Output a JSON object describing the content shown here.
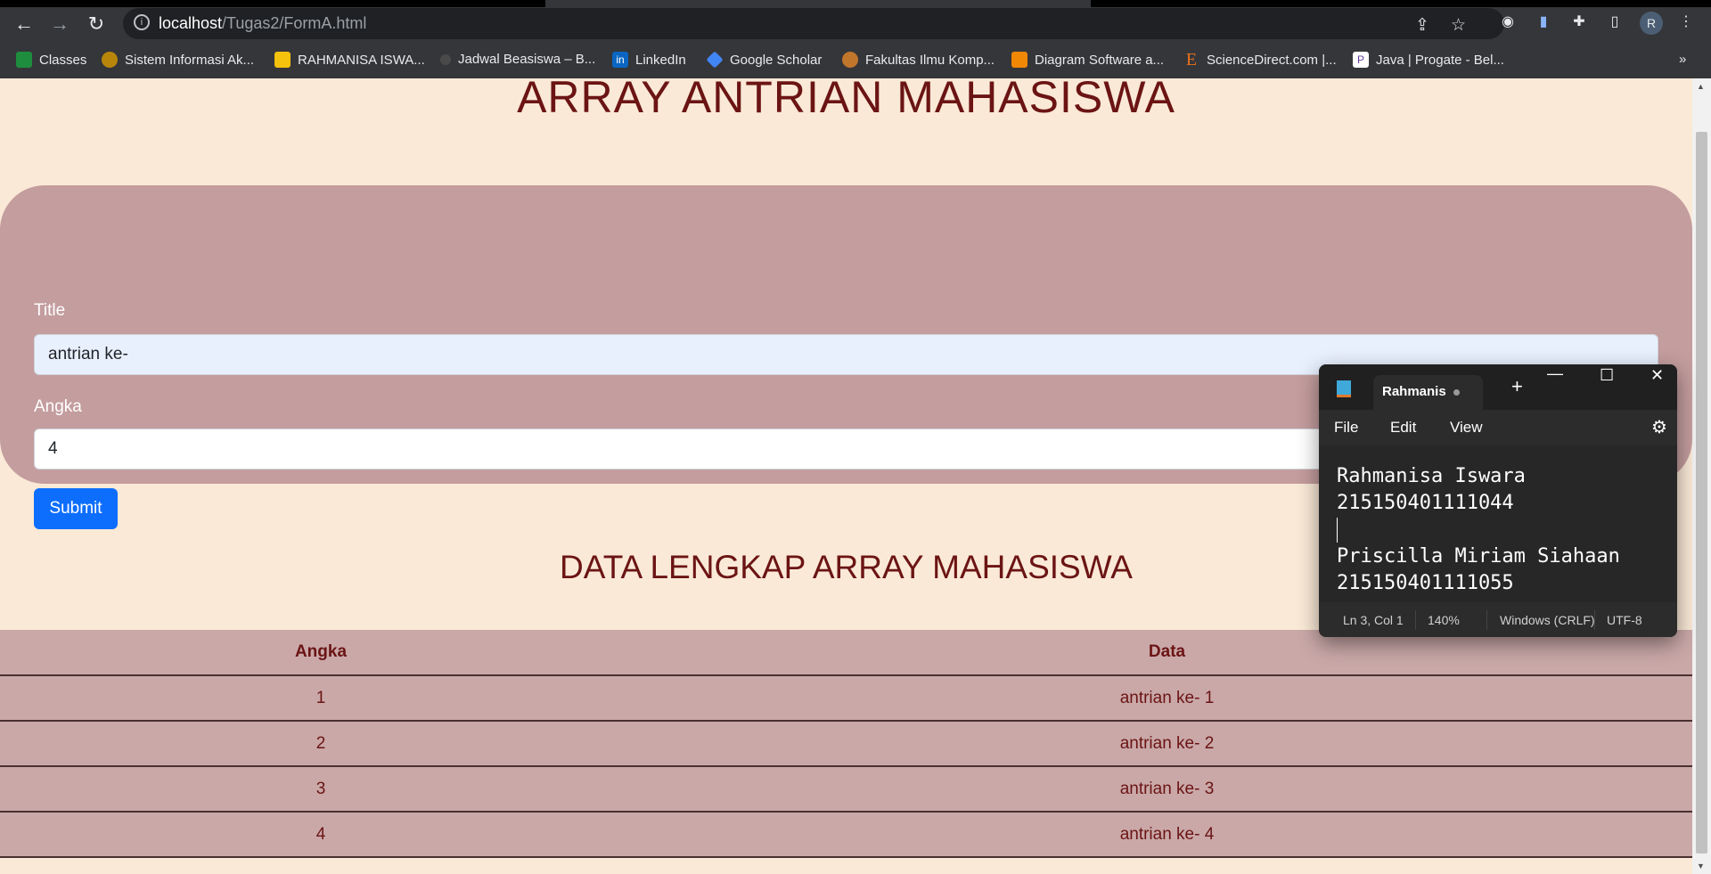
{
  "browser": {
    "url_host": "localhost",
    "url_path": "/Tugas2/FormA.html",
    "avatar_initial": "R",
    "bookmarks": [
      {
        "label": "Classes",
        "icon": "google-classroom-icon",
        "color": "#1e8e3e"
      },
      {
        "label": "Sistem Informasi Ak...",
        "icon": "university-seal-icon",
        "color": "#b8860b"
      },
      {
        "label": "RAHMANISA ISWA...",
        "icon": "lightbulb-icon",
        "color": "#f4c20d"
      },
      {
        "label": "Jadwal Beasiswa – B...",
        "icon": "seal-icon",
        "color": "#4a4a4a"
      },
      {
        "label": "LinkedIn",
        "icon": "linkedin-icon",
        "color": "#0a66c2"
      },
      {
        "label": "Google Scholar",
        "icon": "scholar-icon",
        "color": "#4285f4"
      },
      {
        "label": "Fakultas Ilmu Komp...",
        "icon": "faculty-icon",
        "color": "#c0762b"
      },
      {
        "label": "Diagram Software a...",
        "icon": "drawio-icon",
        "color": "#f08705"
      },
      {
        "label": "ScienceDirect.com |...",
        "icon": "elsevier-icon",
        "color": "#e9711c"
      },
      {
        "label": "Java | Progate - Bel...",
        "icon": "progate-icon",
        "color": "#ffffff"
      }
    ],
    "more_bookmarks": "»"
  },
  "page": {
    "title": "ARRAY ANTRIAN MAHASISWA",
    "form": {
      "title_label": "Title",
      "title_value": "antrian ke-",
      "angka_label": "Angka",
      "angka_value": "4",
      "submit_label": "Submit"
    },
    "table_title": "DATA LENGKAP ARRAY MAHASISWA",
    "table": {
      "headers": [
        "Angka",
        "Data"
      ],
      "rows": [
        [
          "1",
          "antrian ke- 1"
        ],
        [
          "2",
          "antrian ke- 2"
        ],
        [
          "3",
          "antrian ke- 3"
        ],
        [
          "4",
          "antrian ke- 4"
        ]
      ]
    }
  },
  "notepad": {
    "tab_title": "Rahmanis",
    "menu": [
      "File",
      "Edit",
      "View"
    ],
    "lines": [
      "Rahmanisa Iswara",
      "215150401111044",
      "",
      "Priscilla Miriam Siahaan",
      "215150401111055"
    ],
    "status": {
      "position": "Ln 3, Col 1",
      "zoom": "140%",
      "line_ending": "Windows (CRLF)",
      "encoding": "UTF-8"
    }
  },
  "colors": {
    "page_bg": "#fae9d6",
    "form_bg": "#c49d9e",
    "heading": "#6b1414",
    "table_bg": "#caa8a8",
    "submit": "#0d6efd"
  }
}
